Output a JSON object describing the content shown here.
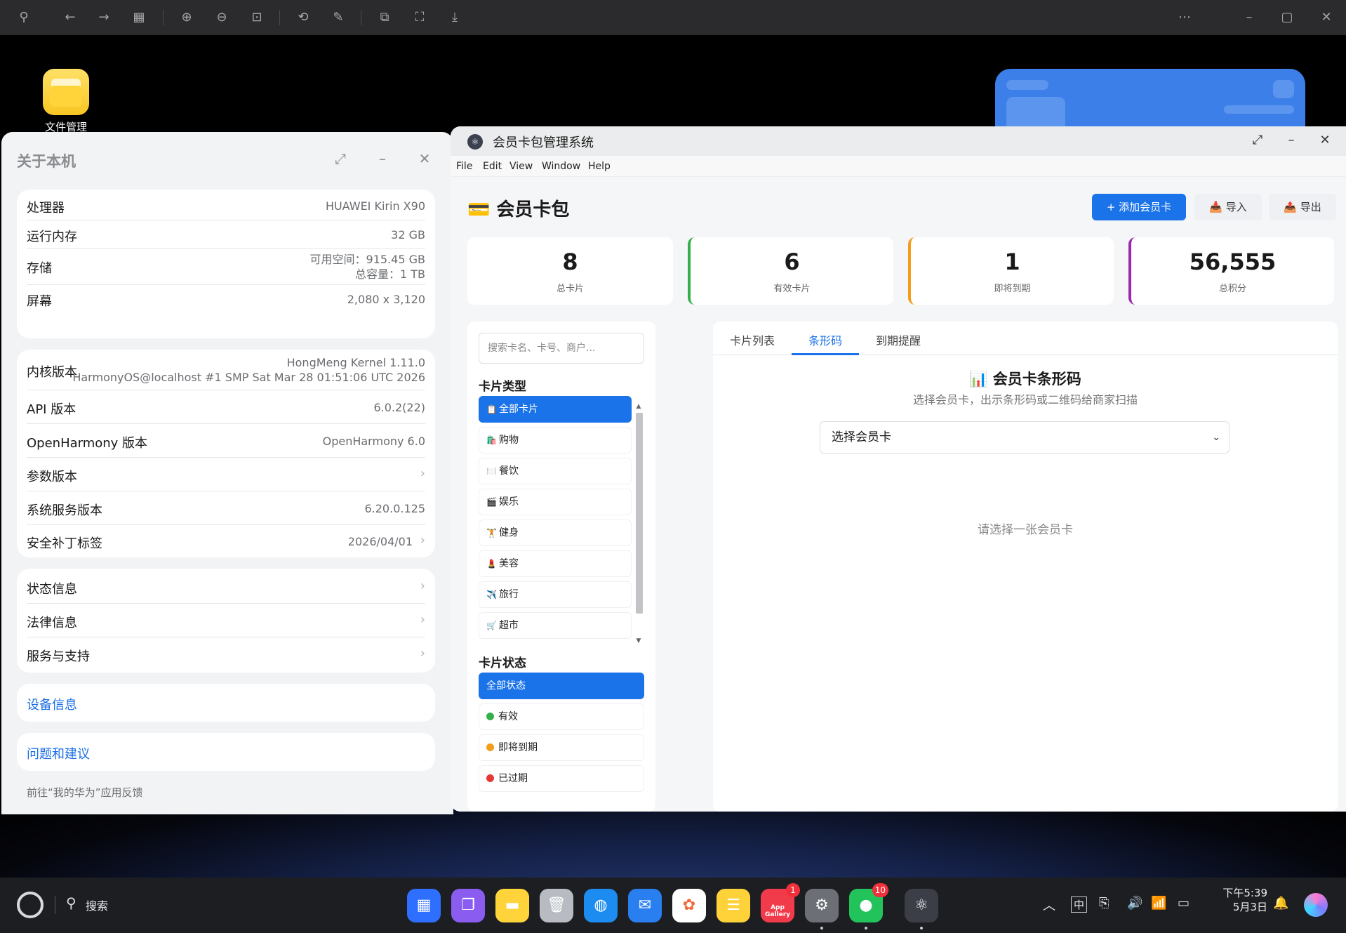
{
  "desktop": {
    "file_manager_label": "文件管理"
  },
  "about_window": {
    "title": "关于本机",
    "specs": [
      {
        "label": "处理器",
        "value": "HUAWEI Kirin X90"
      },
      {
        "label": "运行内存",
        "value": "32 GB"
      },
      {
        "label": "存储",
        "value_line1": "可用空间：915.45 GB",
        "value_line2": "总容量：1 TB"
      },
      {
        "label": "屏幕",
        "value": "2,080 x 3,120"
      }
    ],
    "versions": [
      {
        "label": "内核版本",
        "value_line1": "HongMeng Kernel 1.11.0",
        "value_line2": "HarmonyOS@localhost #1 SMP Sat Mar 28 01:51:06 UTC 2026"
      },
      {
        "label": "API 版本",
        "value": "6.0.2(22)"
      },
      {
        "label": "OpenHarmony 版本",
        "value": "OpenHarmony 6.0"
      },
      {
        "label": "参数版本",
        "value": ""
      },
      {
        "label": "系统服务版本",
        "value": "6.20.0.125"
      },
      {
        "label": "安全补丁标签",
        "value": "2026/04/01"
      }
    ],
    "info_links": [
      {
        "label": "状态信息"
      },
      {
        "label": "法律信息"
      },
      {
        "label": "服务与支持"
      }
    ],
    "device_info_link": "设备信息",
    "feedback_link": "问题和建议",
    "feedback_hint": "前往“我的华为”应用反馈"
  },
  "member_window": {
    "title": "会员卡包管理系统",
    "menu": [
      "File",
      "Edit",
      "View",
      "Window",
      "Help"
    ],
    "page_title": "💳 会员卡包",
    "actions": {
      "add": "+ 添加会员卡",
      "import": "📥 导入",
      "export": "📤 导出"
    },
    "stats": [
      {
        "value": "8",
        "label": "总卡片",
        "accent": ""
      },
      {
        "value": "6",
        "label": "有效卡片",
        "accent": "#34b04a"
      },
      {
        "value": "1",
        "label": "即将到期",
        "accent": "#f59c1a"
      },
      {
        "value": "56,555",
        "label": "总积分",
        "accent": "#9c27b0"
      }
    ],
    "search_placeholder": "搜索卡名、卡号、商户...",
    "card_type_title": "卡片类型",
    "card_types": [
      {
        "icon": "📋",
        "label": "全部卡片",
        "active": true
      },
      {
        "icon": "🛍️",
        "label": "购物"
      },
      {
        "icon": "🍽️",
        "label": "餐饮"
      },
      {
        "icon": "🎬",
        "label": "娱乐"
      },
      {
        "icon": "🏋️",
        "label": "健身"
      },
      {
        "icon": "💄",
        "label": "美容"
      },
      {
        "icon": "✈️",
        "label": "旅行"
      },
      {
        "icon": "🛒",
        "label": "超市"
      }
    ],
    "card_status_title": "卡片状态",
    "card_statuses": [
      {
        "label": "全部状态",
        "active": true,
        "dot": ""
      },
      {
        "label": "有效",
        "dot": "#34b04a"
      },
      {
        "label": "即将到期",
        "dot": "#f59c1a"
      },
      {
        "label": "已过期",
        "dot": "#e53935"
      }
    ],
    "tabs": [
      "卡片列表",
      "条形码",
      "到期提醒"
    ],
    "active_tab": "条形码",
    "barcode_title": "📊 会员卡条形码",
    "barcode_subtitle": "选择会员卡，出示条形码或二维码给商家扫描",
    "select_value": "选择会员卡",
    "empty_hint": "请选择一张会员卡",
    "accent_color": "#1a73e8"
  },
  "taskbar": {
    "search_label": "搜索",
    "apps": [
      {
        "name": "app-center",
        "color": "#2f6fff",
        "badge": ""
      },
      {
        "name": "multitask",
        "color": "#8a5cf0",
        "badge": ""
      },
      {
        "name": "files",
        "color": "#ffd43b",
        "badge": ""
      },
      {
        "name": "trash",
        "color": "#b8bcc2",
        "badge": ""
      },
      {
        "name": "browser",
        "color": "#1d8cf0",
        "badge": ""
      },
      {
        "name": "mail",
        "color": "#2a7ff0",
        "badge": ""
      },
      {
        "name": "gallery",
        "color": "#ffffff",
        "badge": ""
      },
      {
        "name": "notes",
        "color": "#ffd23a",
        "badge": ""
      },
      {
        "name": "app-gallery",
        "color": "#f23b4a",
        "badge": "1",
        "text": "App Gallery"
      },
      {
        "name": "settings",
        "color": "#6c6f75",
        "badge": ""
      },
      {
        "name": "wechat",
        "color": "#23c35c",
        "badge": "10"
      },
      {
        "name": "electron",
        "color": "#3b3e47",
        "badge": ""
      }
    ],
    "ime_label": "中",
    "time": "下午5:39",
    "date": "5月3日"
  }
}
